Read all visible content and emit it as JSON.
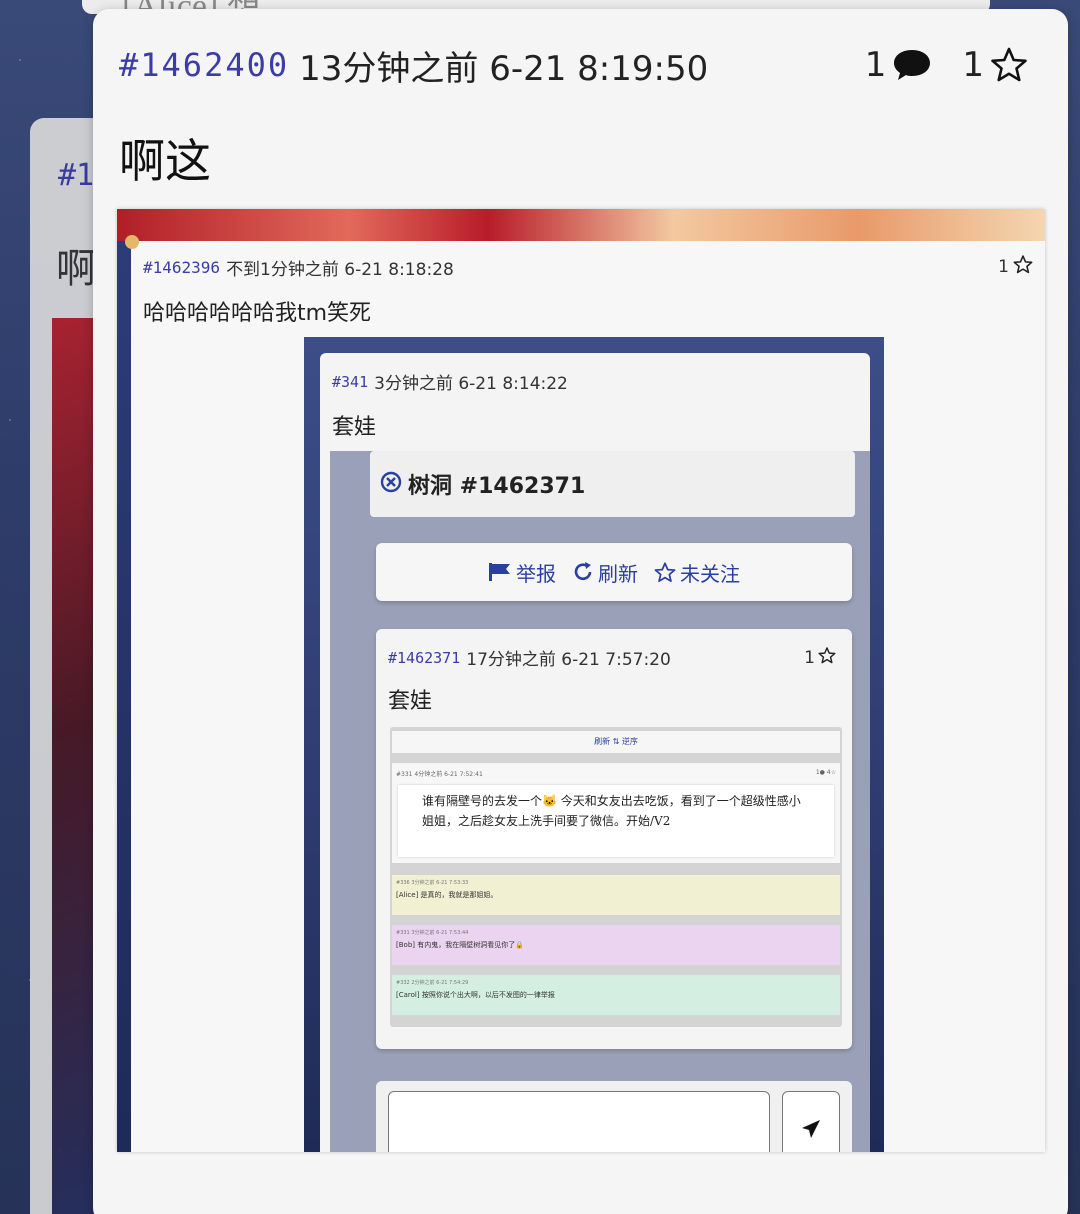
{
  "background": {
    "top_peek_text": "[Alice] 想",
    "back_card": {
      "pid": "#1",
      "text": "啊"
    }
  },
  "post": {
    "pid": "#1462400",
    "time": "13分钟之前 6-21 8:19:50",
    "reply_count": "1",
    "star_count": "1",
    "text": "啊这",
    "icons": [
      "comment-icon",
      "star-icon"
    ]
  },
  "screenshot": {
    "pid": "#1462396",
    "time": "不到1分钟之前 6-21 8:18:28",
    "star_count": "1",
    "text": "哈哈哈哈哈哈我tm笑死",
    "inner": {
      "pid": "#341",
      "time": "3分钟之前 6-21 8:14:22",
      "text": "套娃",
      "hole_title": "树洞 #1462371",
      "actions": [
        {
          "label": "举报",
          "icon": "flag-icon"
        },
        {
          "label": "刷新",
          "icon": "refresh-icon"
        },
        {
          "label": "未关注",
          "icon": "star-icon"
        }
      ],
      "hole_post": {
        "pid": "#1462371",
        "time": "17分钟之前 6-21 7:57:20",
        "star_count": "1",
        "text": "套娃",
        "tiny": {
          "bar": "刷新 ⇅ 逆序",
          "meta": "#331 4分钟之前 6-21 7:52:41",
          "meta_right": "1● 4☆",
          "quote": "谁有隔壁号的去发一个🐱 今天和女友出去吃饭，看到了一个超级性感小姐姐，之后趁女友上洗手间要了微信。开始/V2",
          "replies": [
            {
              "meta": "#336 3分钟之前 6-21 7:53:33",
              "text": "[Alice] 是真的，我就是那姐姐。"
            },
            {
              "meta": "#331 3分钟之前 6-21 7:53:44",
              "text": "[Bob] 有内鬼，我在隔壁树洞看见你了🔒"
            },
            {
              "meta": "#332 2分钟之前 6-21 7:54:29",
              "text": "[Carol] 按照你说个出大啊，以后不发图的一律举报"
            }
          ]
        }
      }
    }
  },
  "colors": {
    "pid": "#3c3ca6",
    "action": "#2a3fa0",
    "card": "#f5f5f5"
  }
}
